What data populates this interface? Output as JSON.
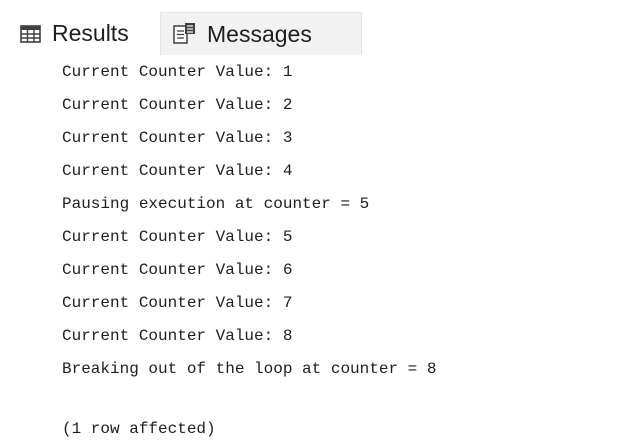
{
  "tabs": {
    "results": {
      "label": "Results",
      "icon": "grid-icon"
    },
    "messages": {
      "label": "Messages",
      "icon": "messages-icon"
    }
  },
  "messages": [
    "Current Counter Value: 1",
    "Current Counter Value: 2",
    "Current Counter Value: 3",
    "Current Counter Value: 4",
    "Pausing execution at counter = 5",
    "Current Counter Value: 5",
    "Current Counter Value: 6",
    "Current Counter Value: 7",
    "Current Counter Value: 8",
    "Breaking out of the loop at counter = 8",
    "(1 row affected)"
  ]
}
